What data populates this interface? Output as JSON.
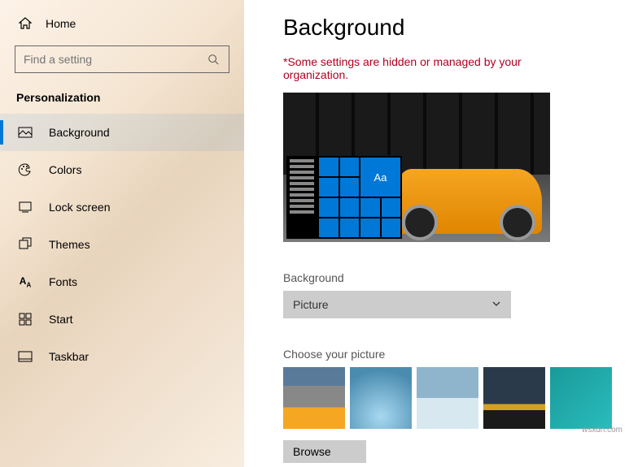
{
  "sidebar": {
    "home": "Home",
    "search_placeholder": "Find a setting",
    "category": "Personalization",
    "items": [
      {
        "label": "Background"
      },
      {
        "label": "Colors"
      },
      {
        "label": "Lock screen"
      },
      {
        "label": "Themes"
      },
      {
        "label": "Fonts"
      },
      {
        "label": "Start"
      },
      {
        "label": "Taskbar"
      }
    ]
  },
  "main": {
    "title": "Background",
    "warning": "*Some settings are hidden or managed by your organization.",
    "preview_tile_text": "Aa",
    "dropdown_label": "Background",
    "dropdown_value": "Picture",
    "choose_label": "Choose your picture",
    "browse": "Browse"
  },
  "watermark": "wsxdn.com"
}
